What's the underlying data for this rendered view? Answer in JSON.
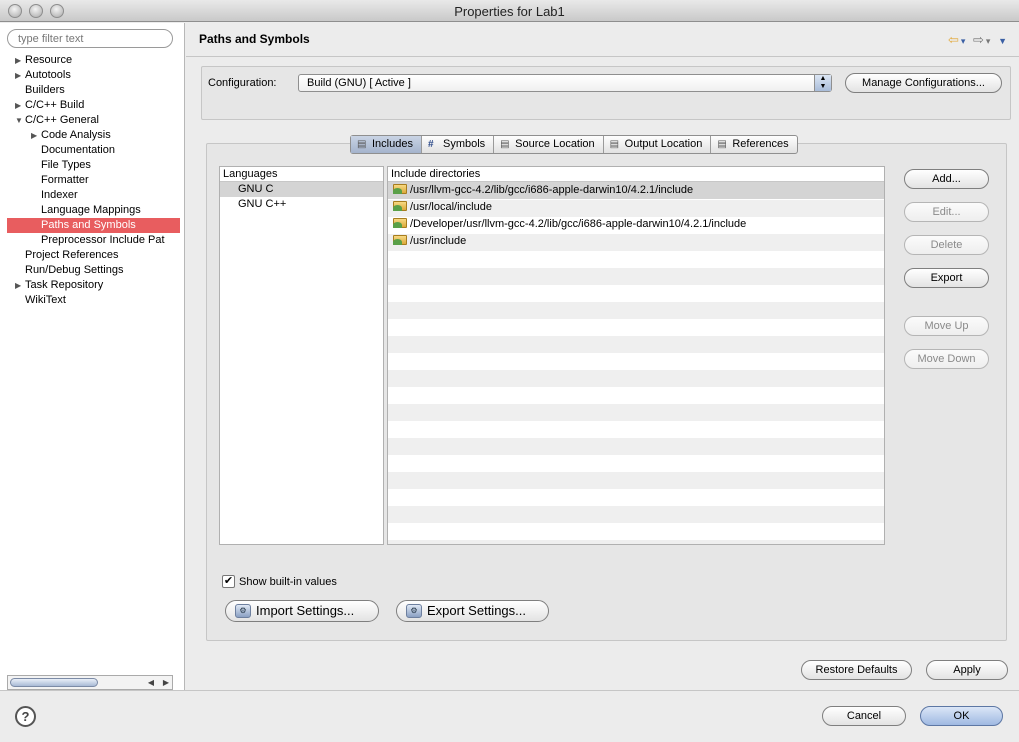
{
  "window": {
    "title": "Properties for Lab1"
  },
  "sidebar": {
    "filter_placeholder": "type filter text",
    "items": [
      {
        "label": "Resource",
        "indent": 0,
        "arrow": "▶"
      },
      {
        "label": "Autotools",
        "indent": 0,
        "arrow": "▶"
      },
      {
        "label": "Builders",
        "indent": 0,
        "arrow": ""
      },
      {
        "label": "C/C++ Build",
        "indent": 0,
        "arrow": "▶"
      },
      {
        "label": "C/C++ General",
        "indent": 0,
        "arrow": "▼"
      },
      {
        "label": "Code Analysis",
        "indent": 1,
        "arrow": "▶"
      },
      {
        "label": "Documentation",
        "indent": 1,
        "arrow": ""
      },
      {
        "label": "File Types",
        "indent": 1,
        "arrow": ""
      },
      {
        "label": "Formatter",
        "indent": 1,
        "arrow": ""
      },
      {
        "label": "Indexer",
        "indent": 1,
        "arrow": ""
      },
      {
        "label": "Language Mappings",
        "indent": 1,
        "arrow": ""
      },
      {
        "label": "Paths and Symbols",
        "indent": 1,
        "arrow": "",
        "selected": true
      },
      {
        "label": "Preprocessor Include Pat",
        "indent": 1,
        "arrow": ""
      },
      {
        "label": "Project References",
        "indent": 0,
        "arrow": ""
      },
      {
        "label": "Run/Debug Settings",
        "indent": 0,
        "arrow": ""
      },
      {
        "label": "Task Repository",
        "indent": 0,
        "arrow": "▶"
      },
      {
        "label": "WikiText",
        "indent": 0,
        "arrow": ""
      }
    ]
  },
  "header": {
    "title": "Paths and Symbols",
    "back_icon": "back-arrow-icon",
    "forward_icon": "forward-arrow-icon",
    "menu_icon": "view-menu-icon"
  },
  "configuration": {
    "label": "Configuration:",
    "value": "Build (GNU)  [ Active ]",
    "manage_button": "Manage Configurations..."
  },
  "tabs": [
    {
      "label": "Includes",
      "icon": "includes-icon",
      "active": true
    },
    {
      "label": "Symbols",
      "icon": "hash-icon"
    },
    {
      "label": "Source Location",
      "icon": "source-folder-icon"
    },
    {
      "label": "Output Location",
      "icon": "output-folder-icon"
    },
    {
      "label": "References",
      "icon": "references-icon"
    }
  ],
  "languages": {
    "header": "Languages",
    "items": [
      "GNU C",
      "GNU C++"
    ],
    "selected_index": 0
  },
  "includes": {
    "header": "Include directories",
    "items": [
      "/usr/llvm-gcc-4.2/lib/gcc/i686-apple-darwin10/4.2.1/include",
      "/usr/local/include",
      "/Developer/usr/llvm-gcc-4.2/lib/gcc/i686-apple-darwin10/4.2.1/include",
      "/usr/include"
    ],
    "selected_index": 0
  },
  "side_buttons": {
    "add": "Add...",
    "edit": "Edit...",
    "delete": "Delete",
    "export": "Export",
    "move_up": "Move Up",
    "move_down": "Move Down"
  },
  "show_builtin": {
    "label": "Show built-in values",
    "checked": true
  },
  "import_settings": "Import Settings...",
  "export_settings": "Export Settings...",
  "restore_defaults": "Restore Defaults",
  "apply": "Apply",
  "cancel": "Cancel",
  "ok": "OK",
  "colors": {
    "selection_red": "#e85d5f",
    "accent_blue": "#9fb9e2"
  }
}
